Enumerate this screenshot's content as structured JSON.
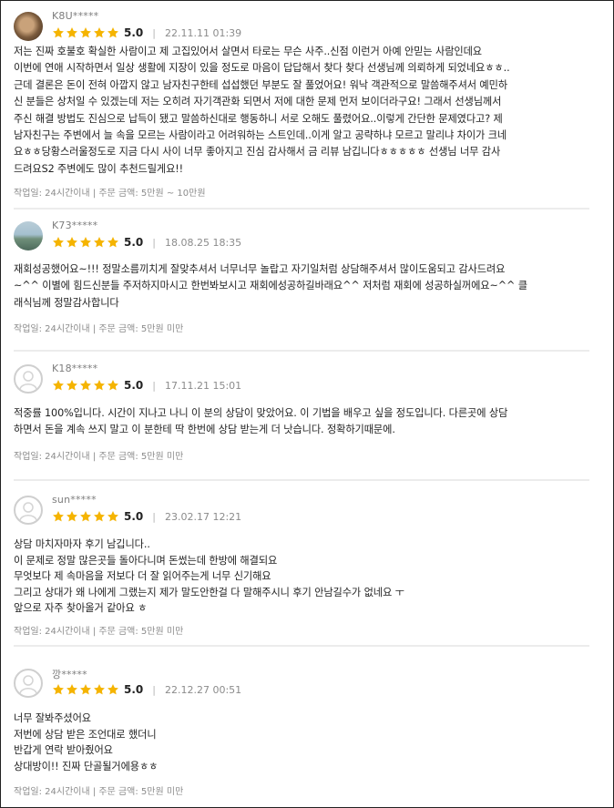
{
  "colors": {
    "star": "#f5b400",
    "text": "#222222",
    "muted": "#8b8b8b",
    "divider": "#ececec"
  },
  "reviews": [
    {
      "avatar": "user-photo",
      "username": "K8U*****",
      "rating": 5,
      "score": "5.0",
      "separator": "|",
      "date": "22.11.11 01:39",
      "body": "저는 진짜 호불호 확실한 사람이고 제 고집있어서 살면서 타로는 무슨 사주..신점 이런거 아예 안믿는 사람인데요\n이번에 연애 시작하면서 일상 생활에 지장이 있을 정도로 마음이 답답해서 찾다 찾다 선생님께 의뢰하게 되었네요ㅎㅎ..\n근데 결론은 돈이 전혀 아깝지 않고 남자친구한테 섭섭했던 부분도 잘 풀었어요! 워낙 객관적으로 말씀해주셔서 예민하\n신 분들은 상처일 수 있겠는데 저는 오히려 자기객관화 되면서 저에 대한 문제 먼저 보이더라구요! 그래서 선생님께서\n주신 해결 방법도 진심으로 납득이 됐고 말씀하신대로 행동하니 서로 오해도 풀렸어요..이렇게 간단한 문제였다고? 제\n남자친구는 주변에서 늘 속을 모르는 사람이라고 어려워하는 스트인데..이게 알고 공략하냐 모르고 말리냐 차이가 크네\n요ㅎㅎ당황스러울정도로 지금 다시 사이 너무 좋아지고 진심 감사해서 금 리뷰 남깁니다ㅎㅎㅎㅎㅎ 선생님 너무 감사\n드려요S2 주변에도 많이 추천드릴게요!!",
      "meta": "작업일: 24시간이내 | 주문 금액: 5만원 ~ 10만원"
    },
    {
      "avatar": "user-photo",
      "username": "K73*****",
      "rating": 5,
      "score": "5.0",
      "separator": "|",
      "date": "18.08.25 18:35",
      "body": "재회성공했어요~!!! 정말소름끼치게 잘맞추셔서 너무너무 놀랍고 자기일처럼 상담해주셔서 많이도움되고 감사드려요\n~^^ 이별에 힘드신분들 주저하지마시고 한번봐보시고 재회에성공하길바래요^^ 저처럼 재회에 성공하실꺼에요~^^ 클\n래식님께 정말감사합니다",
      "meta": "작업일: 24시간이내 | 주문 금액: 5만원 미만"
    },
    {
      "avatar": "default",
      "username": "K18*****",
      "rating": 5,
      "score": "5.0",
      "separator": "|",
      "date": "17.11.21 15:01",
      "body": "적중률 100%입니다. 시간이 지나고 나니 이 분의 상담이 맞았어요.  이 기법을 배우고 싶을 정도입니다. 다른곳에 상담\n하면서 돈을 계속 쓰지 말고 이 분한테 딱 한번에 상담 받는게 더 낫습니다. 정확하기때문에.",
      "meta": "작업일: 24시간이내 | 주문 금액: 5만원 미만"
    },
    {
      "avatar": "default",
      "username": "sun*****",
      "rating": 5,
      "score": "5.0",
      "separator": "|",
      "date": "23.02.17 12:21",
      "body": "상담 마치자마자 후기 남깁니다..\n이 문제로 정말 많은곳들 돌아다니며 돈썼는데 한방에 해결되요\n무엇보다 제 속마음을 저보다 더 잘 읽어주는게 너무 신기해요\n그리고 상대가 왜 나에게 그랬는지 제가 말도안한걸 다 말해주시니 후기 안남길수가 없네요 ㅜ\n앞으로 자주 찾아올거 같아요 ㅎ",
      "meta": "작업일: 24시간이내 | 주문 금액: 5만원 미만"
    },
    {
      "avatar": "default",
      "username": "깡*****",
      "rating": 5,
      "score": "5.0",
      "separator": "|",
      "date": "22.12.27 00:51",
      "body": "너무 잘봐주셨어요\n저번에 상담 받은 조언대로 했더니\n반갑게  연락 받아줬어요\n상대방이!!  진짜 단골될거에용ㅎㅎ",
      "meta": "작업일: 24시간이내 | 주문 금액: 5만원 미만"
    }
  ]
}
